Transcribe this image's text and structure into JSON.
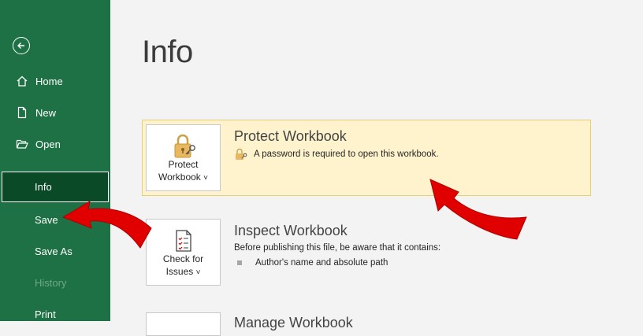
{
  "sidebar": {
    "items": [
      {
        "label": "Home",
        "icon": "home-icon"
      },
      {
        "label": "New",
        "icon": "new-document-icon"
      },
      {
        "label": "Open",
        "icon": "open-folder-icon"
      },
      {
        "label": "Info",
        "selected": true
      },
      {
        "label": "Save"
      },
      {
        "label": "Save As"
      },
      {
        "label": "History",
        "disabled": true
      },
      {
        "label": "Print"
      }
    ]
  },
  "main": {
    "title": "Info",
    "protect": {
      "tile_line1": "Protect",
      "tile_line2": "Workbook",
      "caret": "˅",
      "title": "Protect Workbook",
      "description": "A password is required to open this workbook."
    },
    "inspect": {
      "tile_line1": "Check for",
      "tile_line2": "Issues",
      "caret": "˅",
      "title": "Inspect Workbook",
      "description": "Before publishing this file, be aware that it contains:",
      "bullets": [
        "Author's name and absolute path"
      ]
    },
    "manage": {
      "title": "Manage Workbook"
    }
  },
  "colors": {
    "sidebar_bg": "#1e7145",
    "selected_bg": "#0b4a27",
    "highlight_bg": "#fff3cd",
    "arrow": "#e00000"
  }
}
